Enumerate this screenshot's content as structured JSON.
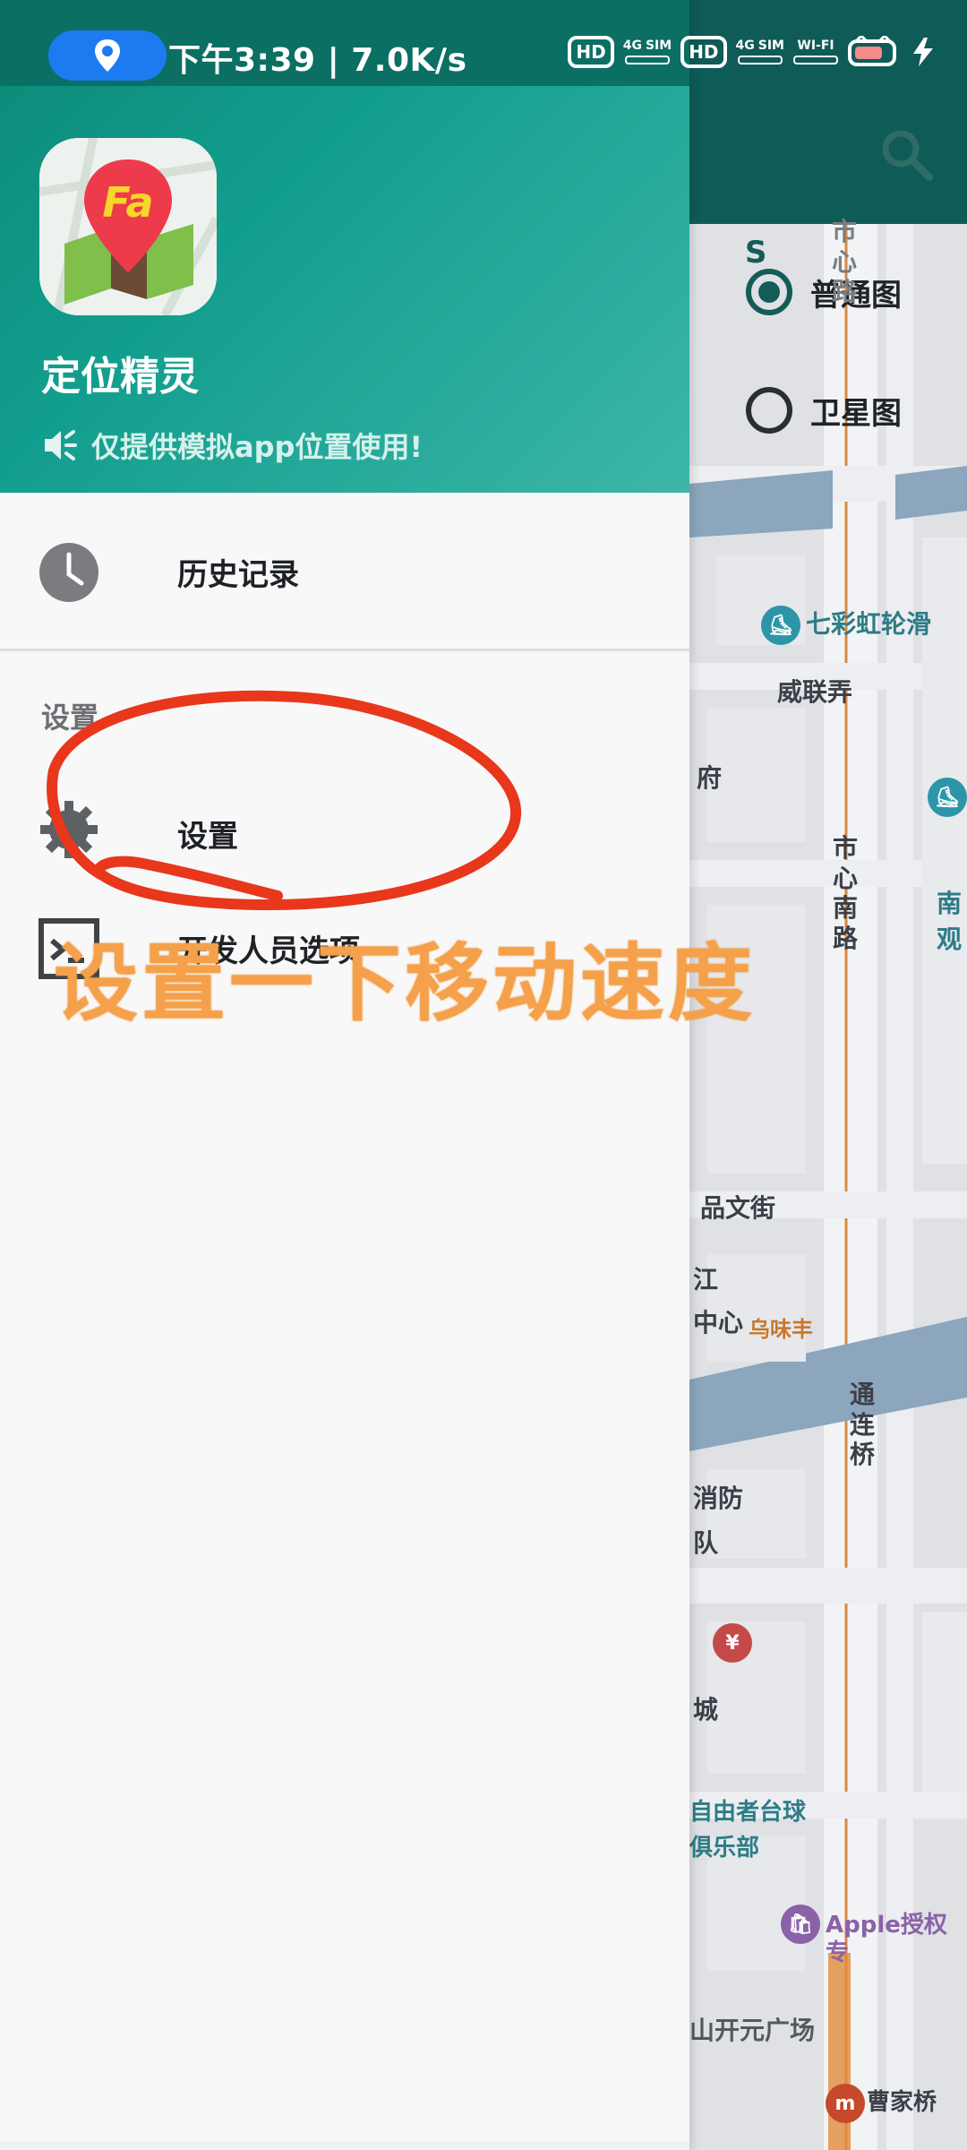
{
  "status_bar": {
    "time_speed": "下午3:39 | 7.0K/s",
    "hd1": "HD",
    "hd2": "HD",
    "net1": "4G",
    "sim1": "SIM",
    "net2": "4G",
    "sim2": "SIM",
    "wifi": "WI-FI"
  },
  "drawer": {
    "app_name": "定位精灵",
    "app_icon_letters": "Fa",
    "notice": "仅提供模拟app位置使用!",
    "menu": {
      "history_label": "历史记录",
      "section_header": "设置",
      "settings_label": "设置",
      "developer_label": "开发人员选项"
    }
  },
  "map": {
    "map_types": [
      "普通图",
      "卫星图"
    ],
    "selected_map_type": "普通图",
    "labels": {
      "road_top": "市心路",
      "qicaihong": "七彩虹轮滑",
      "weilian": "威联弄",
      "fu": "府",
      "road_south": "市心南路",
      "nan": "南",
      "guan": "观",
      "pinwen": "品文街",
      "jiang": "江",
      "xin": "中心",
      "wuweifeng": "乌味丰",
      "tonglian": "通连桥",
      "xiaofang": "消防",
      "dui": "队",
      "cheng": "城",
      "billiards": "自由者台球",
      "club": "俱乐部",
      "apple": "Apple授权专",
      "kaiyuan": "山开元广场",
      "caojiaqiao": "曹家桥"
    }
  },
  "annotation": {
    "text": "设置一下移动速度"
  },
  "colors": {
    "drawer_header": "#129e8e",
    "status_pill": "#1d7bf2",
    "annotation_text": "#f5a14b",
    "annotation_ring": "#e8371b",
    "map_topbar": "#0f5b57"
  }
}
